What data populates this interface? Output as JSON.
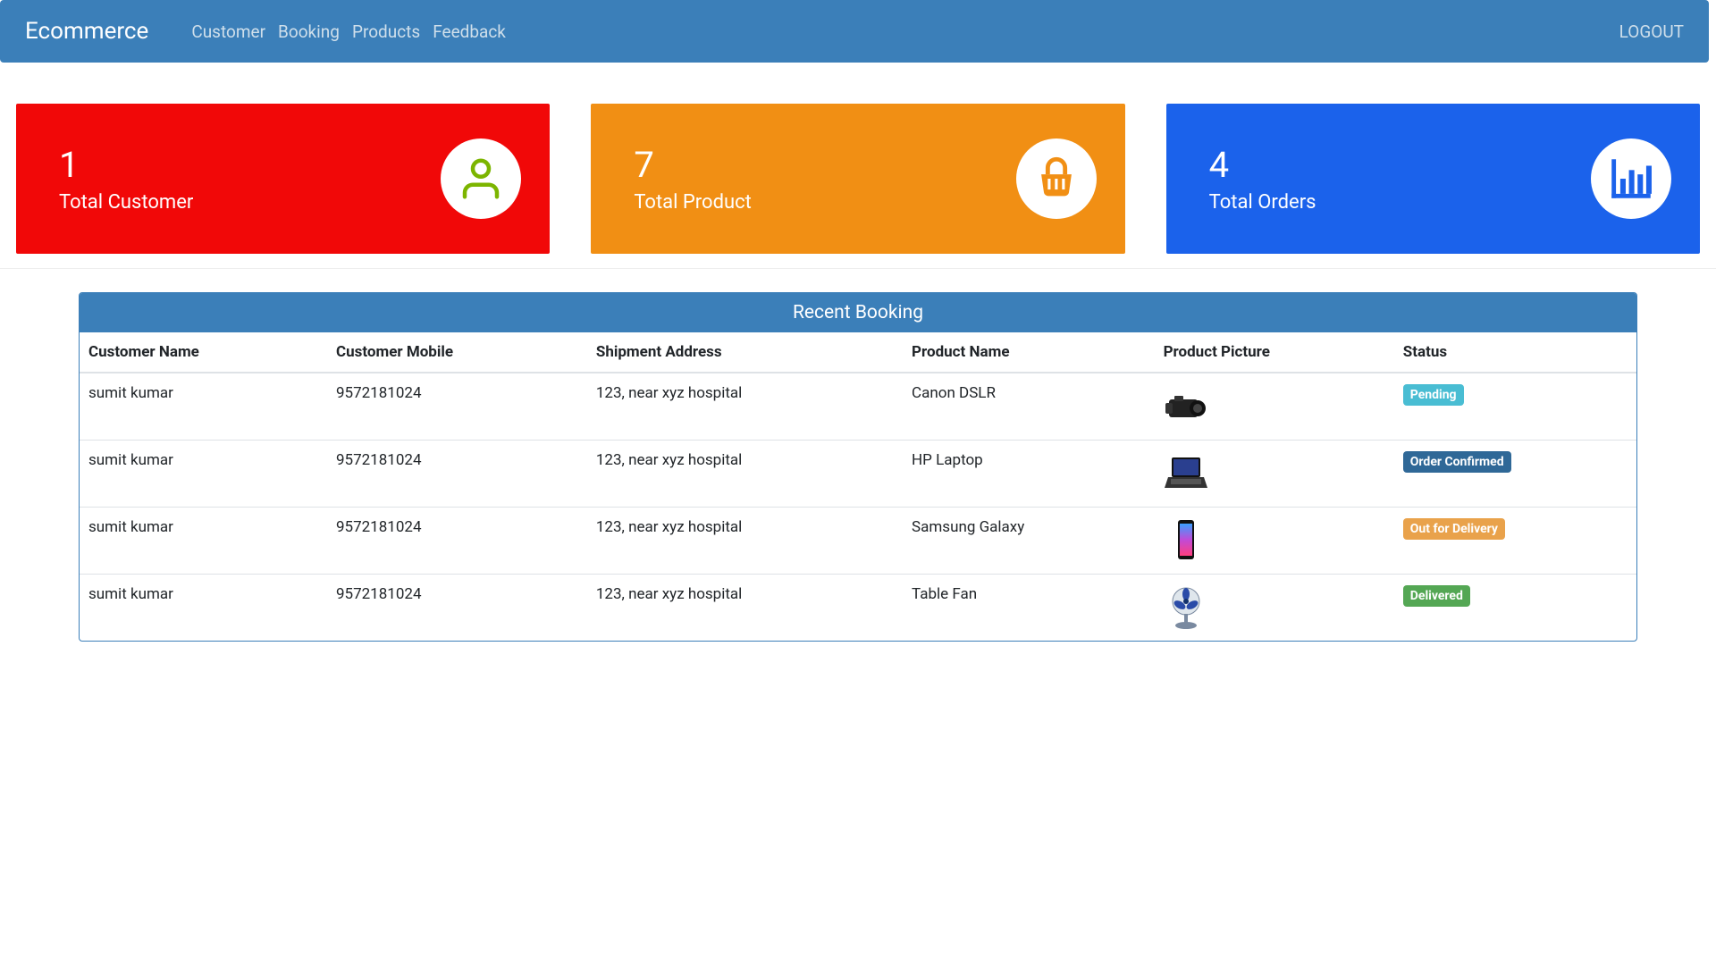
{
  "nav": {
    "brand": "Ecommerce",
    "links": [
      {
        "label": "Customer"
      },
      {
        "label": "Booking"
      },
      {
        "label": "Products"
      },
      {
        "label": "Feedback"
      }
    ],
    "logout": "LOGOUT"
  },
  "stats": {
    "customer": {
      "count": "1",
      "label": "Total Customer",
      "color": "#f10808",
      "icon": "user-icon",
      "icon_color": "#7cb500"
    },
    "product": {
      "count": "7",
      "label": "Total Product",
      "color": "#f18f14",
      "icon": "basket-icon",
      "icon_color": "#f18f14"
    },
    "orders": {
      "count": "4",
      "label": "Total Orders",
      "color": "#1b62eb",
      "icon": "bar-chart-icon",
      "icon_color": "#1b62eb"
    }
  },
  "booking": {
    "title": "Recent Booking",
    "columns": {
      "name": "Customer Name",
      "mobile": "Customer Mobile",
      "address": "Shipment Address",
      "product": "Product Name",
      "picture": "Product Picture",
      "status": "Status"
    },
    "status_colors": {
      "Pending": "#49bdd3",
      "Order Confirmed": "#2f6897",
      "Out for Delivery": "#e9a24b",
      "Delivered": "#54a754"
    },
    "rows": [
      {
        "name": "sumit kumar",
        "mobile": "9572181024",
        "address": "123, near xyz hospital",
        "product": "Canon DSLR",
        "picture": "camera",
        "status": "Pending"
      },
      {
        "name": "sumit kumar",
        "mobile": "9572181024",
        "address": "123, near xyz hospital",
        "product": "HP Laptop",
        "picture": "laptop",
        "status": "Order Confirmed"
      },
      {
        "name": "sumit kumar",
        "mobile": "9572181024",
        "address": "123, near xyz hospital",
        "product": "Samsung Galaxy",
        "picture": "phone",
        "status": "Out for Delivery"
      },
      {
        "name": "sumit kumar",
        "mobile": "9572181024",
        "address": "123, near xyz hospital",
        "product": "Table Fan",
        "picture": "fan",
        "status": "Delivered"
      }
    ]
  }
}
